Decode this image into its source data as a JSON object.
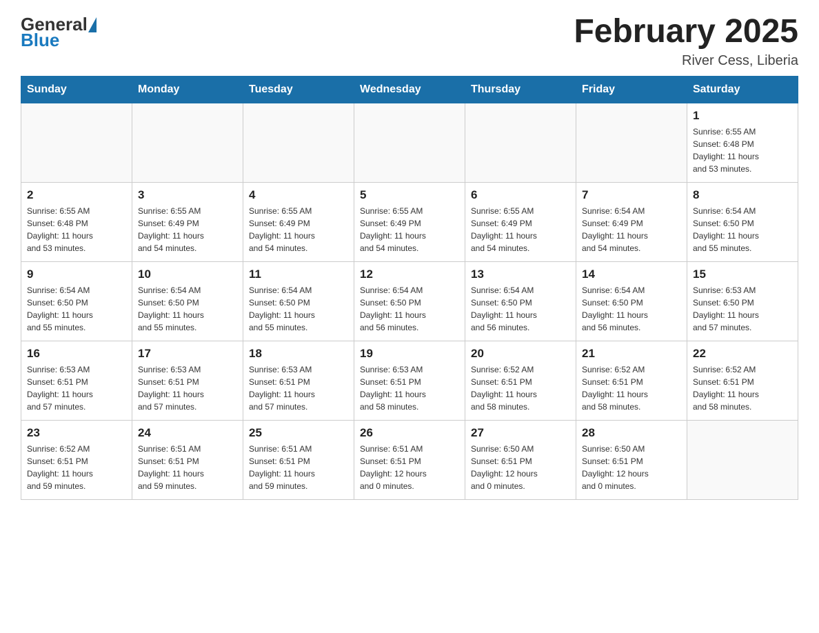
{
  "header": {
    "logo_general": "General",
    "logo_blue": "Blue",
    "month_title": "February 2025",
    "subtitle": "River Cess, Liberia"
  },
  "days_of_week": [
    "Sunday",
    "Monday",
    "Tuesday",
    "Wednesday",
    "Thursday",
    "Friday",
    "Saturday"
  ],
  "weeks": [
    [
      {
        "day": "",
        "info": ""
      },
      {
        "day": "",
        "info": ""
      },
      {
        "day": "",
        "info": ""
      },
      {
        "day": "",
        "info": ""
      },
      {
        "day": "",
        "info": ""
      },
      {
        "day": "",
        "info": ""
      },
      {
        "day": "1",
        "info": "Sunrise: 6:55 AM\nSunset: 6:48 PM\nDaylight: 11 hours\nand 53 minutes."
      }
    ],
    [
      {
        "day": "2",
        "info": "Sunrise: 6:55 AM\nSunset: 6:48 PM\nDaylight: 11 hours\nand 53 minutes."
      },
      {
        "day": "3",
        "info": "Sunrise: 6:55 AM\nSunset: 6:49 PM\nDaylight: 11 hours\nand 54 minutes."
      },
      {
        "day": "4",
        "info": "Sunrise: 6:55 AM\nSunset: 6:49 PM\nDaylight: 11 hours\nand 54 minutes."
      },
      {
        "day": "5",
        "info": "Sunrise: 6:55 AM\nSunset: 6:49 PM\nDaylight: 11 hours\nand 54 minutes."
      },
      {
        "day": "6",
        "info": "Sunrise: 6:55 AM\nSunset: 6:49 PM\nDaylight: 11 hours\nand 54 minutes."
      },
      {
        "day": "7",
        "info": "Sunrise: 6:54 AM\nSunset: 6:49 PM\nDaylight: 11 hours\nand 54 minutes."
      },
      {
        "day": "8",
        "info": "Sunrise: 6:54 AM\nSunset: 6:50 PM\nDaylight: 11 hours\nand 55 minutes."
      }
    ],
    [
      {
        "day": "9",
        "info": "Sunrise: 6:54 AM\nSunset: 6:50 PM\nDaylight: 11 hours\nand 55 minutes."
      },
      {
        "day": "10",
        "info": "Sunrise: 6:54 AM\nSunset: 6:50 PM\nDaylight: 11 hours\nand 55 minutes."
      },
      {
        "day": "11",
        "info": "Sunrise: 6:54 AM\nSunset: 6:50 PM\nDaylight: 11 hours\nand 55 minutes."
      },
      {
        "day": "12",
        "info": "Sunrise: 6:54 AM\nSunset: 6:50 PM\nDaylight: 11 hours\nand 56 minutes."
      },
      {
        "day": "13",
        "info": "Sunrise: 6:54 AM\nSunset: 6:50 PM\nDaylight: 11 hours\nand 56 minutes."
      },
      {
        "day": "14",
        "info": "Sunrise: 6:54 AM\nSunset: 6:50 PM\nDaylight: 11 hours\nand 56 minutes."
      },
      {
        "day": "15",
        "info": "Sunrise: 6:53 AM\nSunset: 6:50 PM\nDaylight: 11 hours\nand 57 minutes."
      }
    ],
    [
      {
        "day": "16",
        "info": "Sunrise: 6:53 AM\nSunset: 6:51 PM\nDaylight: 11 hours\nand 57 minutes."
      },
      {
        "day": "17",
        "info": "Sunrise: 6:53 AM\nSunset: 6:51 PM\nDaylight: 11 hours\nand 57 minutes."
      },
      {
        "day": "18",
        "info": "Sunrise: 6:53 AM\nSunset: 6:51 PM\nDaylight: 11 hours\nand 57 minutes."
      },
      {
        "day": "19",
        "info": "Sunrise: 6:53 AM\nSunset: 6:51 PM\nDaylight: 11 hours\nand 58 minutes."
      },
      {
        "day": "20",
        "info": "Sunrise: 6:52 AM\nSunset: 6:51 PM\nDaylight: 11 hours\nand 58 minutes."
      },
      {
        "day": "21",
        "info": "Sunrise: 6:52 AM\nSunset: 6:51 PM\nDaylight: 11 hours\nand 58 minutes."
      },
      {
        "day": "22",
        "info": "Sunrise: 6:52 AM\nSunset: 6:51 PM\nDaylight: 11 hours\nand 58 minutes."
      }
    ],
    [
      {
        "day": "23",
        "info": "Sunrise: 6:52 AM\nSunset: 6:51 PM\nDaylight: 11 hours\nand 59 minutes."
      },
      {
        "day": "24",
        "info": "Sunrise: 6:51 AM\nSunset: 6:51 PM\nDaylight: 11 hours\nand 59 minutes."
      },
      {
        "day": "25",
        "info": "Sunrise: 6:51 AM\nSunset: 6:51 PM\nDaylight: 11 hours\nand 59 minutes."
      },
      {
        "day": "26",
        "info": "Sunrise: 6:51 AM\nSunset: 6:51 PM\nDaylight: 12 hours\nand 0 minutes."
      },
      {
        "day": "27",
        "info": "Sunrise: 6:50 AM\nSunset: 6:51 PM\nDaylight: 12 hours\nand 0 minutes."
      },
      {
        "day": "28",
        "info": "Sunrise: 6:50 AM\nSunset: 6:51 PM\nDaylight: 12 hours\nand 0 minutes."
      },
      {
        "day": "",
        "info": ""
      }
    ]
  ]
}
